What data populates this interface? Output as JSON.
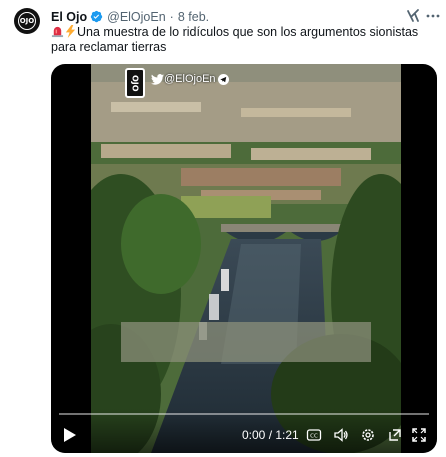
{
  "tweet": {
    "author_name": "El Ojo",
    "handle": "@ElOjoEn",
    "separator": "·",
    "date": "8 feb.",
    "avatar_text": "OJO",
    "text": "Una muestra de lo ridículos que son los argumentos sionistas para reclamar tierras",
    "emojis": [
      "rotating-light-emoji",
      "lightning-emoji"
    ]
  },
  "video": {
    "overlay_logo_text": "OJO",
    "overlay_handle": "@ElOjoEn",
    "time_display": "0:00 / 1:21",
    "progress": 0.0,
    "icons": [
      "play-icon",
      "captions-icon",
      "volume-icon",
      "settings-icon",
      "popout-icon",
      "fullscreen-icon"
    ]
  },
  "colors": {
    "verified_blue": "#1d9bf0",
    "text_primary": "#0f1419",
    "text_secondary": "#536471",
    "media_background": "#000000"
  }
}
